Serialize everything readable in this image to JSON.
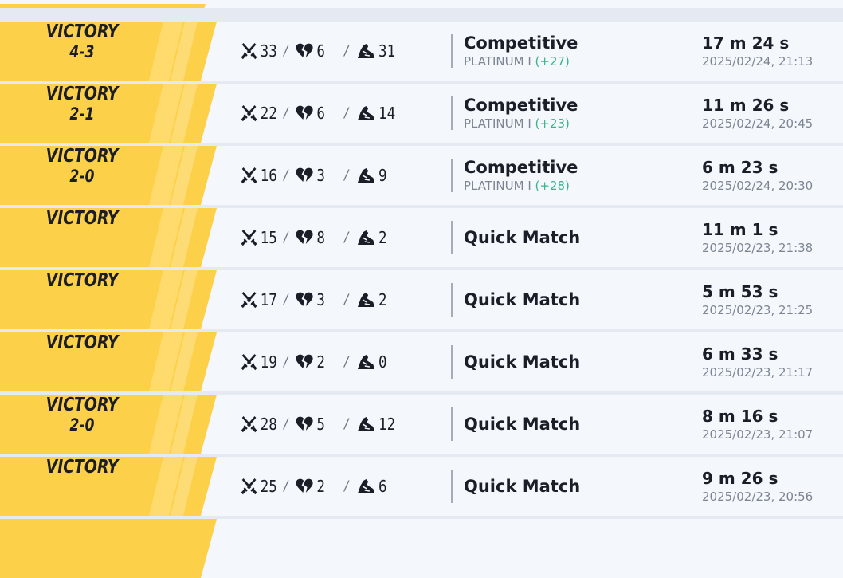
{
  "matches": [
    {
      "result": "VICTORY",
      "score": "4-3",
      "kills": "33",
      "deaths": "6",
      "assists": "31",
      "mode": "Competitive",
      "rank": "PLATINUM I",
      "rank_delta": "(+27)",
      "duration": "17 m 24 s",
      "date": "2025/02/24, 21:13"
    },
    {
      "result": "VICTORY",
      "score": "2-1",
      "kills": "22",
      "deaths": "6",
      "assists": "14",
      "mode": "Competitive",
      "rank": "PLATINUM I",
      "rank_delta": "(+23)",
      "duration": "11 m 26 s",
      "date": "2025/02/24, 20:45"
    },
    {
      "result": "VICTORY",
      "score": "2-0",
      "kills": "16",
      "deaths": "3",
      "assists": "9",
      "mode": "Competitive",
      "rank": "PLATINUM I",
      "rank_delta": "(+28)",
      "duration": "6 m 23 s",
      "date": "2025/02/24, 20:30"
    },
    {
      "result": "VICTORY",
      "score": "",
      "kills": "15",
      "deaths": "8",
      "assists": "2",
      "mode": "Quick Match",
      "rank": "",
      "rank_delta": "",
      "duration": "11 m 1 s",
      "date": "2025/02/23, 21:38"
    },
    {
      "result": "VICTORY",
      "score": "",
      "kills": "17",
      "deaths": "3",
      "assists": "2",
      "mode": "Quick Match",
      "rank": "",
      "rank_delta": "",
      "duration": "5 m 53 s",
      "date": "2025/02/23, 21:25"
    },
    {
      "result": "VICTORY",
      "score": "",
      "kills": "19",
      "deaths": "2",
      "assists": "0",
      "mode": "Quick Match",
      "rank": "",
      "rank_delta": "",
      "duration": "6 m 33 s",
      "date": "2025/02/23, 21:17"
    },
    {
      "result": "VICTORY",
      "score": "2-0",
      "kills": "28",
      "deaths": "5",
      "assists": "12",
      "mode": "Quick Match",
      "rank": "",
      "rank_delta": "",
      "duration": "8 m 16 s",
      "date": "2025/02/23, 21:07"
    },
    {
      "result": "VICTORY",
      "score": "",
      "kills": "25",
      "deaths": "2",
      "assists": "6",
      "mode": "Quick Match",
      "rank": "",
      "rank_delta": "",
      "duration": "9 m 26 s",
      "date": "2025/02/23, 20:56"
    }
  ],
  "icons": {
    "kills": "crossed-swords-icon",
    "deaths": "broken-heart-icon",
    "assists": "helping-hands-icon"
  },
  "colors": {
    "victory_banner": "#fdd04a",
    "rank_delta": "#39b48a",
    "row_bg": "#f4f7fc",
    "page_bg": "#e4e9f2"
  }
}
